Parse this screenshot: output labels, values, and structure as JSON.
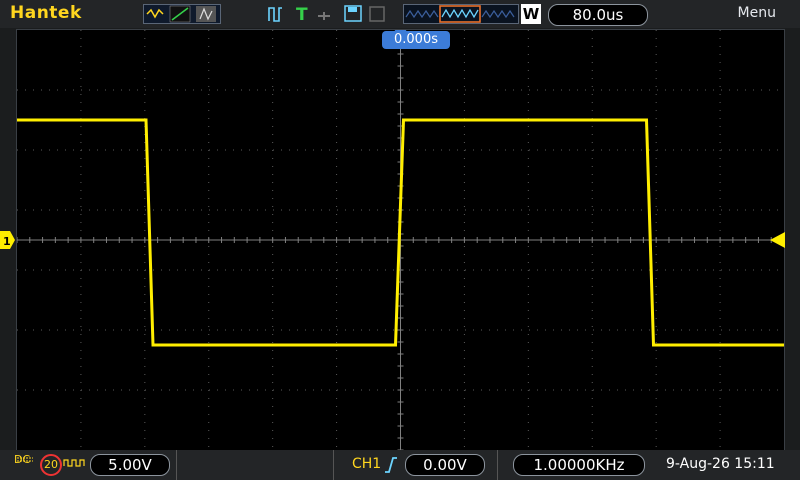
{
  "brand": "Hantek",
  "top": {
    "timebase": "80.0us",
    "acq_mode": "W",
    "menu_label": "Menu"
  },
  "trigger_position": "0.000s",
  "channel_marker": "1",
  "bottom": {
    "coupling": "DC",
    "bw_limit": "20",
    "ch1_volts_div": "5.00V",
    "trigger_source": "CH1",
    "trigger_level": "0.00V",
    "frequency": "1.00000KHz",
    "datetime": "9-Aug-26 15:11"
  },
  "colors": {
    "trace": "#ffee00",
    "brand": "#ffd61f",
    "trigger_marker": "#3c7cd8"
  },
  "waveform": {
    "type": "square",
    "high_div": 2.0,
    "low_div": -1.75
  }
}
